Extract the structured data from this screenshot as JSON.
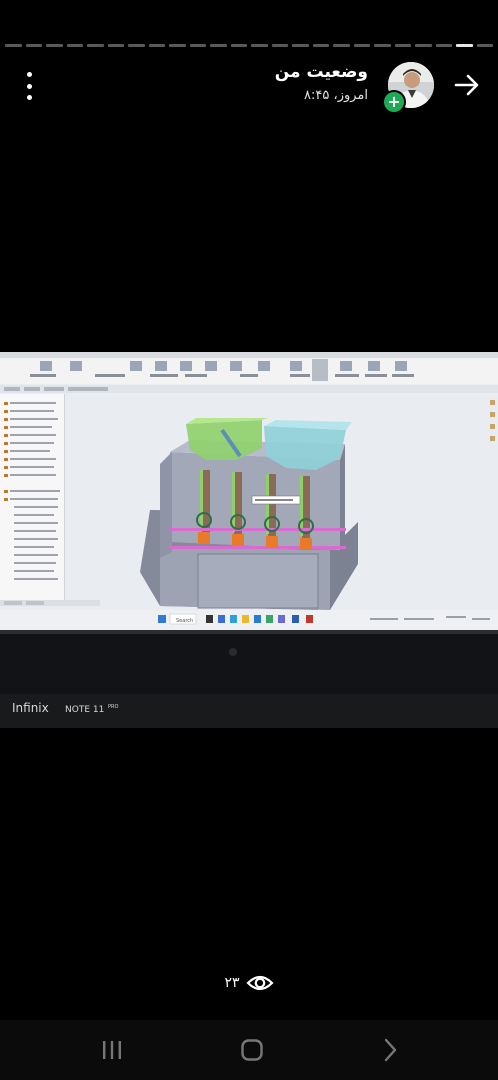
{
  "status": {
    "title": "وضعیت من",
    "time": "امروز، ۸:۴۵",
    "view_count": "۲۳"
  },
  "photo": {
    "phone_brand": "Infinix",
    "phone_model": "NOTE 11",
    "phone_model_suffix": "PRO",
    "taskbar_search": "Search"
  },
  "icons": {
    "menu": "more-vertical-icon",
    "back": "arrow-right-icon",
    "add": "plus-icon",
    "views": "eye-icon",
    "nav_recents": "recents-icon",
    "nav_home": "home-icon",
    "nav_back": "chevron-back-icon"
  },
  "colors": {
    "background": "#000000",
    "badge": "#1fa855",
    "cad_model_grey": "#9ea3b4",
    "cad_green": "#8fd06a",
    "cad_cyan": "#8ed0d8",
    "cad_orange": "#e87a2a"
  }
}
